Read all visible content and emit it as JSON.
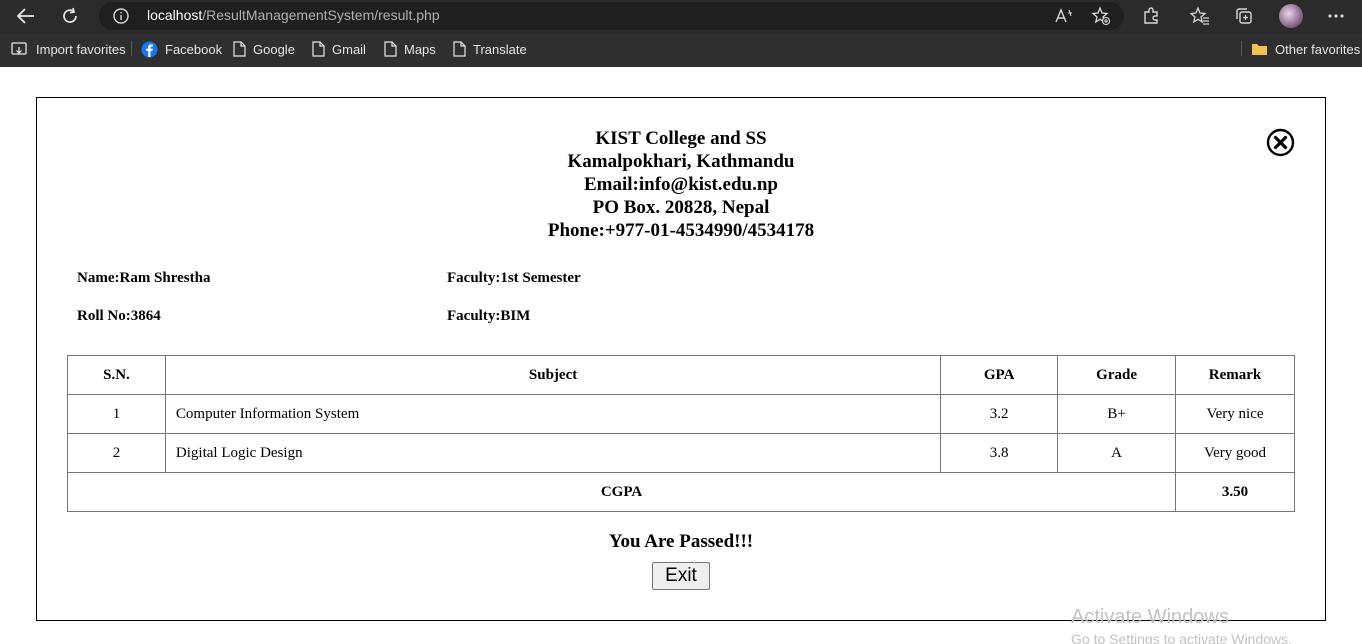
{
  "browser": {
    "url_host": "localhost",
    "url_path": "/ResultManagementSystem/result.php",
    "bookmarks": {
      "import_favorites": "Import favorites",
      "facebook": "Facebook",
      "google": "Google",
      "gmail": "Gmail",
      "maps": "Maps",
      "translate": "Translate",
      "other_favorites": "Other favorites"
    }
  },
  "header": {
    "college": "KIST College and SS",
    "address": "Kamalpokhari, Kathmandu",
    "email": "Email:info@kist.edu.np",
    "po_box": "PO Box. 20828, Nepal",
    "phone": "Phone:+977-01-4534990/4534178"
  },
  "student": {
    "name": "Name:Ram Shrestha",
    "faculty_semester": "Faculty:1st Semester",
    "roll_no": "Roll No:3864",
    "faculty": "Faculty:BIM"
  },
  "table": {
    "headers": [
      "S.N.",
      "Subject",
      "GPA",
      "Grade",
      "Remark"
    ],
    "rows": [
      {
        "sn": "1",
        "subject": "Computer Information System",
        "gpa": "3.2",
        "grade": "B+",
        "remark": "Very nice"
      },
      {
        "sn": "2",
        "subject": "Digital Logic Design",
        "gpa": "3.8",
        "grade": "A",
        "remark": "Very good"
      }
    ],
    "cgpa_label": "CGPA",
    "cgpa_value": "3.50"
  },
  "result_message": "You Are Passed!!!",
  "exit_label": "Exit",
  "watermark": {
    "line1": "Activate Windows",
    "line2": "Go to Settings to activate Windows."
  },
  "icons": {
    "back": "back-arrow-icon",
    "refresh": "refresh-icon",
    "info": "info-icon",
    "read_aloud": "read-aloud-icon",
    "add_favorite": "add-favorite-icon",
    "extensions": "extensions-icon",
    "favorites": "favorites-icon",
    "collections": "collections-icon",
    "more": "more-icon",
    "close": "close-icon"
  }
}
